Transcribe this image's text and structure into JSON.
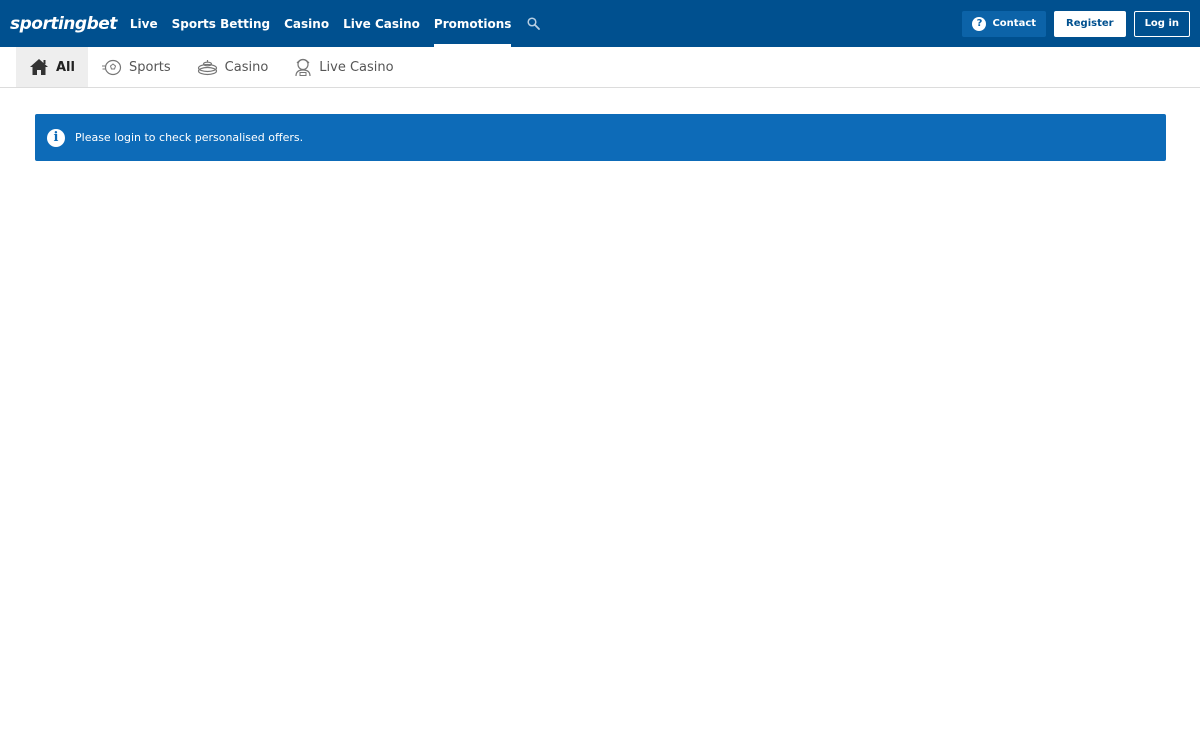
{
  "header": {
    "logo_text": "sportingbet",
    "nav": [
      {
        "label": "Live"
      },
      {
        "label": "Sports Betting"
      },
      {
        "label": "Casino"
      },
      {
        "label": "Live Casino"
      },
      {
        "label": "Promotions",
        "active": true
      }
    ],
    "search_icon": "search-icon",
    "contact_label": "Contact",
    "register_label": "Register",
    "login_label": "Log in"
  },
  "subnav": {
    "tabs": [
      {
        "label": "All",
        "icon": "home-icon",
        "active": true
      },
      {
        "label": "Sports",
        "icon": "football-icon"
      },
      {
        "label": "Casino",
        "icon": "casino-chips-icon"
      },
      {
        "label": "Live Casino",
        "icon": "dealer-icon"
      }
    ]
  },
  "banner": {
    "message": "Please login to check personalised offers.",
    "icon": "info-icon"
  },
  "colors": {
    "header_bg": "#00508f",
    "banner_bg": "#0d6bb8",
    "active_tab_bg": "#eeeeee"
  }
}
